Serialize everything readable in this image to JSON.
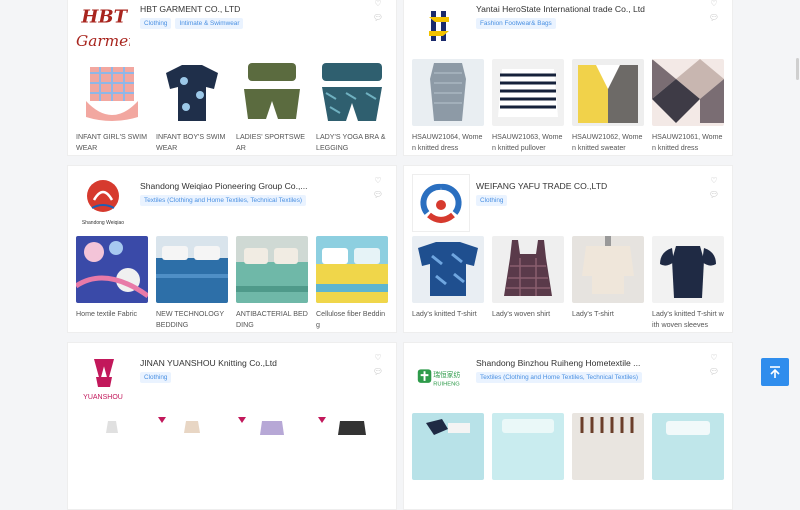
{
  "cards": [
    {
      "company": "HBT GARMENT CO., LTD",
      "logo_text": [
        "HBT",
        "Garment"
      ],
      "tags": [
        "Clothing",
        "Intimate & Swimwear"
      ],
      "products": [
        {
          "label": "INFANT GIRL'S SWIMWEAR"
        },
        {
          "label": "INFANT BOY'S SWIMWEAR"
        },
        {
          "label": "LADIES' SPORTSWEAR"
        },
        {
          "label": "LADY'S YOGA BRA & LEGGING"
        }
      ]
    },
    {
      "company": "Yantai HeroState International trade Co., Ltd",
      "logo_text": [],
      "tags": [
        "Fashion Footwear& Bags"
      ],
      "products": [
        {
          "label": "HSAUW21064, Women knitted dress"
        },
        {
          "label": "HSAUW21063, Women knitted pullover"
        },
        {
          "label": "HSAUW21062, Women knitted sweater"
        },
        {
          "label": "HSAUW21061, Women knitted dress"
        }
      ]
    },
    {
      "company": "Shandong Weiqiao Pioneering Group Co.,...",
      "logo_text": [
        "Shandong Weiqiao"
      ],
      "tags": [
        "Textiles (Clothing and Home Textiles, Technical Textiles)"
      ],
      "products": [
        {
          "label": "Home textile Fabric"
        },
        {
          "label": "NEW TECHNOLOGY BEDDING"
        },
        {
          "label": "ANTIBACTERIAL BEDDING"
        },
        {
          "label": "Cellulose fiber Bedding"
        }
      ]
    },
    {
      "company": "WEIFANG YAFU TRADE CO.,LTD",
      "logo_text": [],
      "tags": [
        "Clothing"
      ],
      "products": [
        {
          "label": "Lady's knitted T-shirt"
        },
        {
          "label": "Lady's woven shirt"
        },
        {
          "label": "Lady's T-shirt"
        },
        {
          "label": "Lady's knitted T-shirt with woven sleeves"
        }
      ]
    },
    {
      "company": "JINAN YUANSHOU Knitting Co.,Ltd",
      "logo_text": [
        "YUANSHOU"
      ],
      "tags": [
        "Clothing"
      ],
      "products": [
        {
          "label": ""
        },
        {
          "label": ""
        },
        {
          "label": ""
        },
        {
          "label": ""
        }
      ]
    },
    {
      "company": "Shandong Binzhou Ruiheng Hometextile ...",
      "logo_text": [
        "瑞恒家纺",
        "RUIHENG"
      ],
      "tags": [
        "Textiles (Clothing and Home Textiles, Technical Textiles)"
      ],
      "products": [
        {
          "label": ""
        },
        {
          "label": ""
        },
        {
          "label": ""
        },
        {
          "label": ""
        }
      ]
    }
  ],
  "icons": {
    "favorite": "heart-icon",
    "message": "chat-icon",
    "back_to_top": "arrow-up-icon"
  },
  "colors": {
    "tag_bg": "#eaf3ff",
    "tag_text": "#4a90e2",
    "back_to_top": "#2f8ded",
    "hbt_red": "#a8251e"
  }
}
